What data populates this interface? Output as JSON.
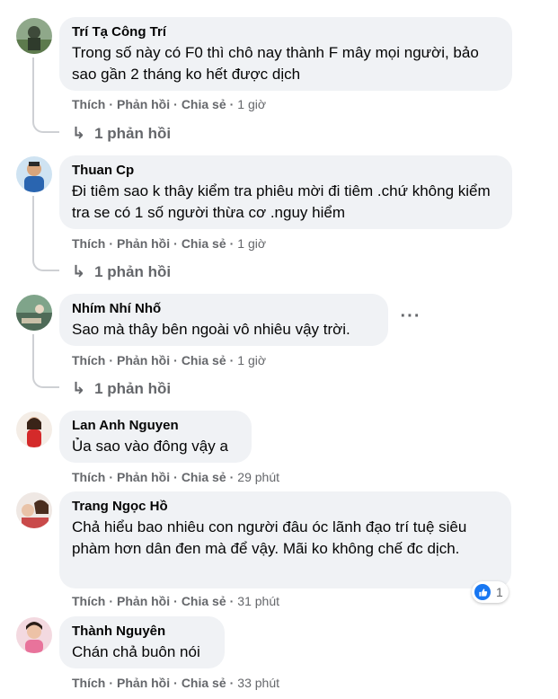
{
  "labels": {
    "like": "Thích",
    "reply": "Phản hồi",
    "share": "Chia sẻ",
    "separator": "·"
  },
  "comments": [
    {
      "author": "Trí Tạ Công Trí",
      "text": "Trong số này có F0 thì chô nay thành F mây mọi người, bảo sao gần 2 tháng ko hết được dịch",
      "time": "1 giờ",
      "replies": "1 phản hồi"
    },
    {
      "author": "Thuan Cp",
      "text": "Đi tiêm sao k thây kiểm tra phiêu mời đi tiêm .chứ không kiểm tra se có 1 số người thừa cơ .nguy hiểm",
      "time": "1 giờ",
      "replies": "1 phản hồi"
    },
    {
      "author": "Nhím Nhí Nhố",
      "text": "Sao mà thây bên ngoài vô nhiêu vậy trời.",
      "time": "1 giờ",
      "replies": "1 phản hồi"
    },
    {
      "author": "Lan Anh Nguyen",
      "text": "Ủa sao vào đông vậy a",
      "time": "29 phút"
    },
    {
      "author": "Trang Ngọc Hồ",
      "text": "Chả hiểu bao nhiêu con người đâu óc lãnh đạo trí tuệ siêu phàm hơn dân đen mà để vậy. Mãi ko không chế đc dịch.",
      "time": "31 phút",
      "reaction": {
        "icon": "like-icon",
        "count": "1"
      }
    },
    {
      "author": "Thành Nguyên",
      "text": "Chán chả buôn nói",
      "time": "33 phút"
    }
  ],
  "more_button_label": "···",
  "colors": {
    "bubble": "#f0f2f5",
    "meta": "#65676b",
    "like_blue": "#1877f2"
  }
}
